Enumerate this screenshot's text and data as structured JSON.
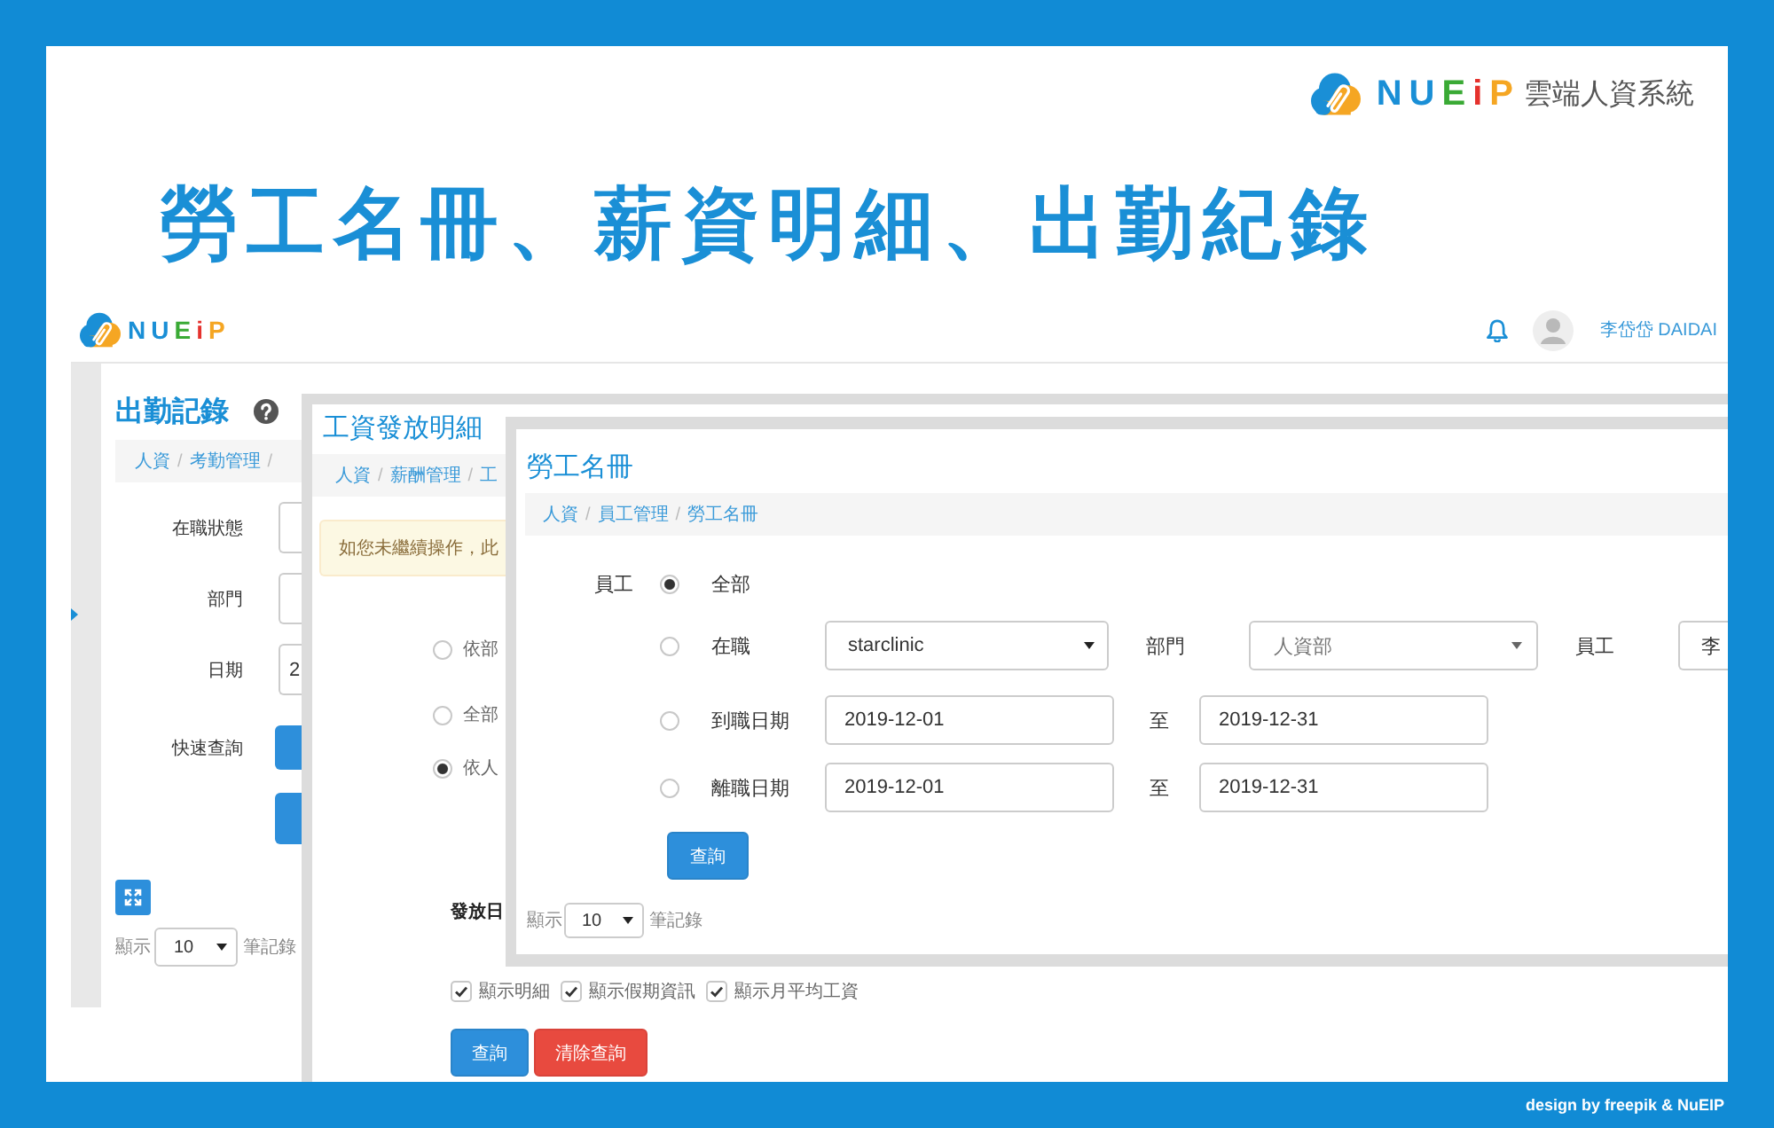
{
  "brand": {
    "logo_text": "NUEiP",
    "tagline": "雲端人資系統"
  },
  "headline": "勞工名冊、薪資明細、出勤紀錄",
  "app": {
    "header": {
      "logo_text": "NUEiP",
      "user_name": "李岱岱 DAIDAI"
    },
    "attendance": {
      "title": "出勤記錄",
      "breadcrumb": [
        {
          "kind": "link",
          "text": "人資"
        },
        {
          "kind": "separator",
          "text": "/"
        },
        {
          "kind": "link",
          "text": "考勤管理"
        },
        {
          "kind": "separator",
          "text": "/"
        }
      ],
      "fields": [
        {
          "kind": "input",
          "label": "在職狀態"
        },
        {
          "kind": "input",
          "label": "部門"
        },
        {
          "kind": "input",
          "label": "日期",
          "value": "2"
        },
        {
          "kind": "button",
          "label": "快速查詢"
        },
        {
          "kind": "button"
        }
      ],
      "page_size": {
        "prefix": "顯示",
        "value": "10",
        "suffix": "筆記錄"
      }
    },
    "payroll": {
      "title": "工資發放明細",
      "breadcrumb": [
        {
          "kind": "link",
          "text": "人資"
        },
        {
          "kind": "separator",
          "text": "/"
        },
        {
          "kind": "link",
          "text": "薪酬管理"
        },
        {
          "kind": "separator",
          "text": "/"
        },
        {
          "kind": "link",
          "text": "工"
        }
      ],
      "alert": "如您未繼續操作，此",
      "radios": [
        {
          "label": "依部",
          "selected": false
        },
        {
          "label": "全部",
          "selected": false
        },
        {
          "label": "依人",
          "selected": true
        }
      ],
      "date_label": "發放日",
      "checkboxes": [
        {
          "label": "顯示明細",
          "checked": true
        },
        {
          "label": "顯示假期資訊",
          "checked": true
        },
        {
          "label": "顯示月平均工資",
          "checked": true
        }
      ],
      "buttons": [
        {
          "kind": "primary",
          "label": "查詢"
        },
        {
          "kind": "danger",
          "label": "清除查詢"
        }
      ]
    },
    "roster": {
      "title": "勞工名冊",
      "breadcrumb": [
        {
          "kind": "link",
          "text": "人資"
        },
        {
          "kind": "separator",
          "text": "/"
        },
        {
          "kind": "link",
          "text": "員工管理"
        },
        {
          "kind": "separator",
          "text": "/"
        },
        {
          "kind": "link",
          "text": "勞工名冊"
        }
      ],
      "filter_label": "員工",
      "options": [
        {
          "label": "全部",
          "selected": true
        },
        {
          "label": "在職",
          "selected": false,
          "controls": [
            {
              "kind": "select",
              "value": "starclinic"
            },
            {
              "kind": "label",
              "text": "部門"
            },
            {
              "kind": "dropdown",
              "value": "人資部"
            },
            {
              "kind": "label",
              "text": "員工"
            },
            {
              "kind": "input",
              "value": "李"
            }
          ]
        },
        {
          "label": "到職日期",
          "selected": false,
          "controls": [
            {
              "kind": "date",
              "value": "2019-12-01"
            },
            {
              "kind": "separator",
              "text": "至"
            },
            {
              "kind": "date",
              "value": "2019-12-31"
            }
          ]
        },
        {
          "label": "離職日期",
          "selected": false,
          "controls": [
            {
              "kind": "date",
              "value": "2019-12-01"
            },
            {
              "kind": "separator",
              "text": "至"
            },
            {
              "kind": "date",
              "value": "2019-12-31"
            }
          ]
        }
      ],
      "button": "查詢",
      "page_size": {
        "prefix": "顯示",
        "value": "10",
        "suffix": "筆記錄"
      }
    }
  },
  "credit": "design by freepik & NuEIP"
}
